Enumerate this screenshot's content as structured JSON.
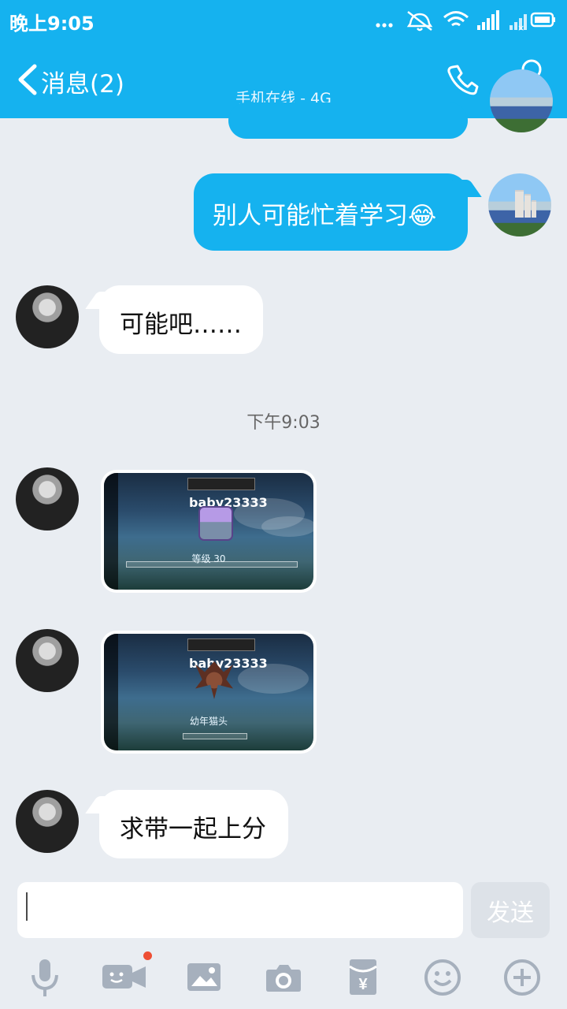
{
  "status_bar": {
    "time": "晚上9:05",
    "icons": [
      "more-dots-icon",
      "mute-bell-icon",
      "wifi-icon",
      "signal-icon",
      "signal-weak-icon",
      "battery-icon"
    ]
  },
  "header": {
    "back_label": "消息(2)",
    "status": "手机在线 - 4G",
    "icons": [
      "phone-call-icon",
      "profile-icon"
    ]
  },
  "chat": {
    "messages": [
      {
        "side": "right",
        "type": "text",
        "text": "别人可能忙着学习😂"
      },
      {
        "side": "left",
        "type": "text",
        "text": "可能吧……"
      },
      {
        "type": "time",
        "text": "下午9:03"
      },
      {
        "side": "left",
        "type": "image",
        "image_text": "baby23333",
        "caption": "等级 30"
      },
      {
        "side": "left",
        "type": "image",
        "image_text": "baby23333",
        "caption": "幼年猫头"
      },
      {
        "side": "left",
        "type": "text",
        "text": "求带一起上分"
      }
    ]
  },
  "input": {
    "value": "",
    "send_label": "发送"
  },
  "toolbar": {
    "items": [
      "voice-mic-icon",
      "video-icon",
      "picture-icon",
      "camera-icon",
      "red-packet-icon",
      "emoji-icon",
      "plus-icon"
    ]
  },
  "colors": {
    "brand_blue": "#15b2ef",
    "background": "#e9edf2",
    "bubble_white": "#ffffff",
    "badge_red": "#ee4f34"
  }
}
